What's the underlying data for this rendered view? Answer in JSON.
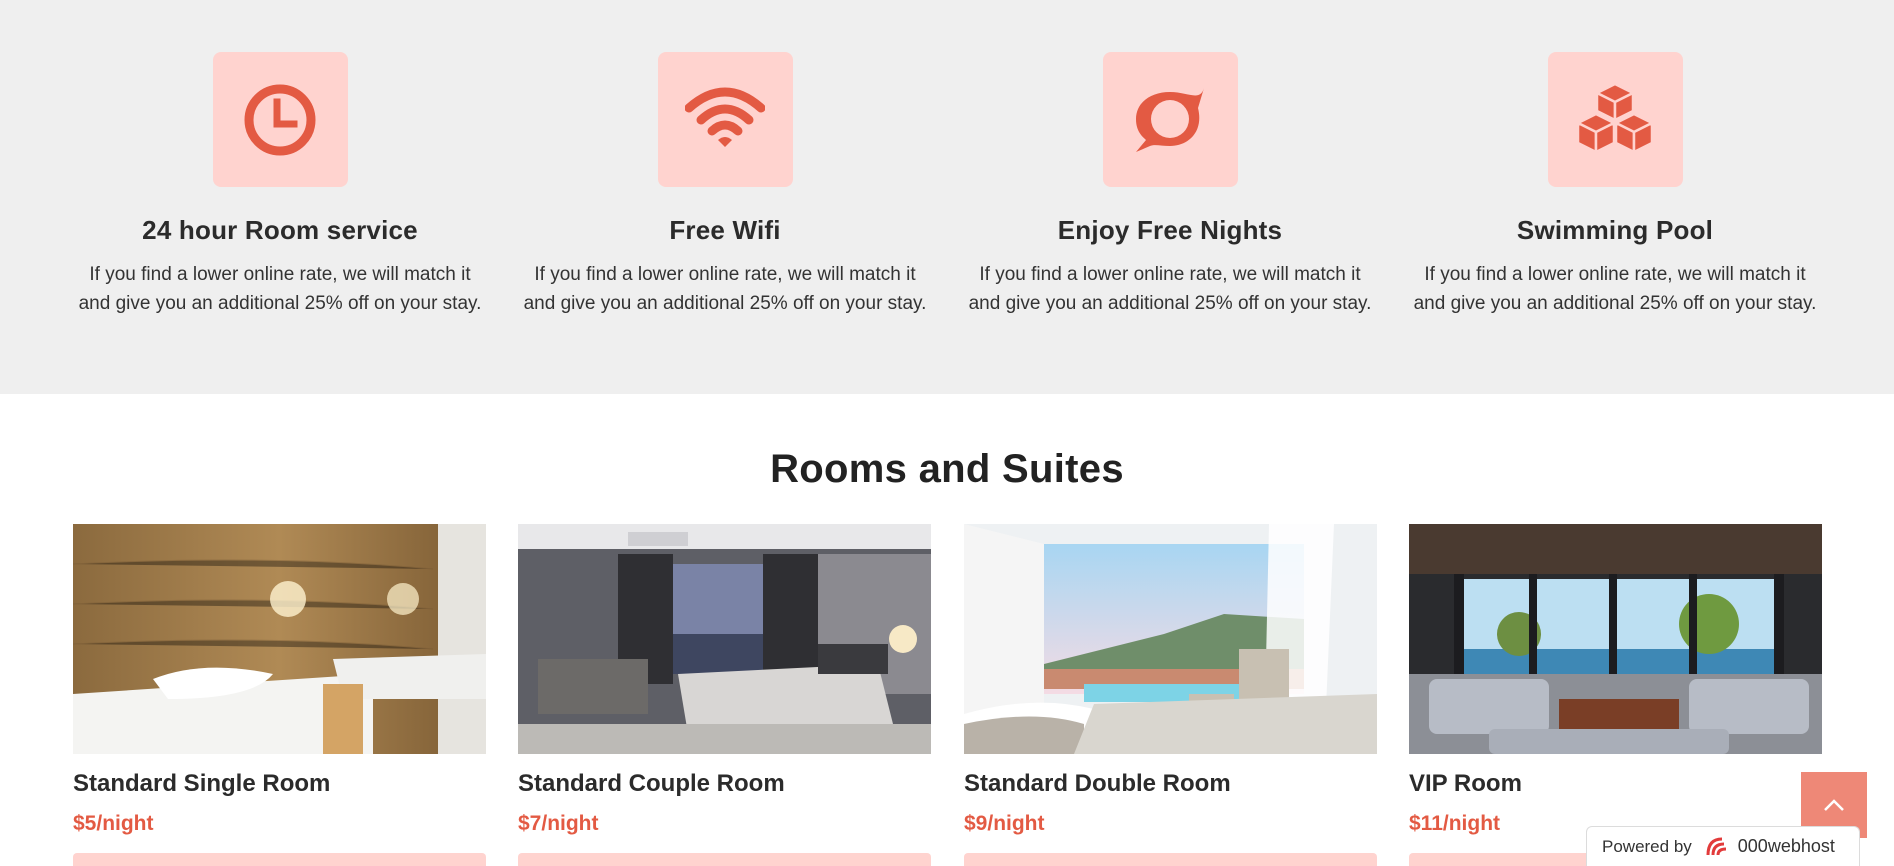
{
  "features": [
    {
      "icon": "clock-icon",
      "title": "24 hour Room service",
      "text": "If you find a lower online rate, we will match it and give you an additional 25% off on your stay."
    },
    {
      "icon": "wifi-icon",
      "title": "Free Wifi",
      "text": "If you find a lower online rate, we will match it and give you an additional 25% off on your stay."
    },
    {
      "icon": "chat-bubble-icon",
      "title": "Enjoy Free Nights",
      "text": "If you find a lower online rate, we will match it and give you an additional 25% off on your stay."
    },
    {
      "icon": "cubes-icon",
      "title": "Swimming Pool",
      "text": "If you find a lower online rate, we will match it and give you an additional 25% off on your stay."
    }
  ],
  "rooms_section": {
    "title": "Rooms and Suites",
    "rooms": [
      {
        "name": "Standard Single Room",
        "price": "$5/night",
        "photo": "single-room-photo"
      },
      {
        "name": "Standard Couple Room",
        "price": "$7/night",
        "photo": "couple-room-photo"
      },
      {
        "name": "Standard Double Room",
        "price": "$9/night",
        "photo": "double-room-photo"
      },
      {
        "name": "VIP Room",
        "price": "$11/night",
        "photo": "vip-room-photo"
      }
    ]
  },
  "back_to_top": {
    "icon": "chevron-up-icon"
  },
  "powered_by": {
    "label": "Powered by",
    "brand": "000webhost"
  },
  "colors": {
    "accent": "#e35a43",
    "icon_bg": "#ffd3cf",
    "section_bg": "#efefef"
  }
}
